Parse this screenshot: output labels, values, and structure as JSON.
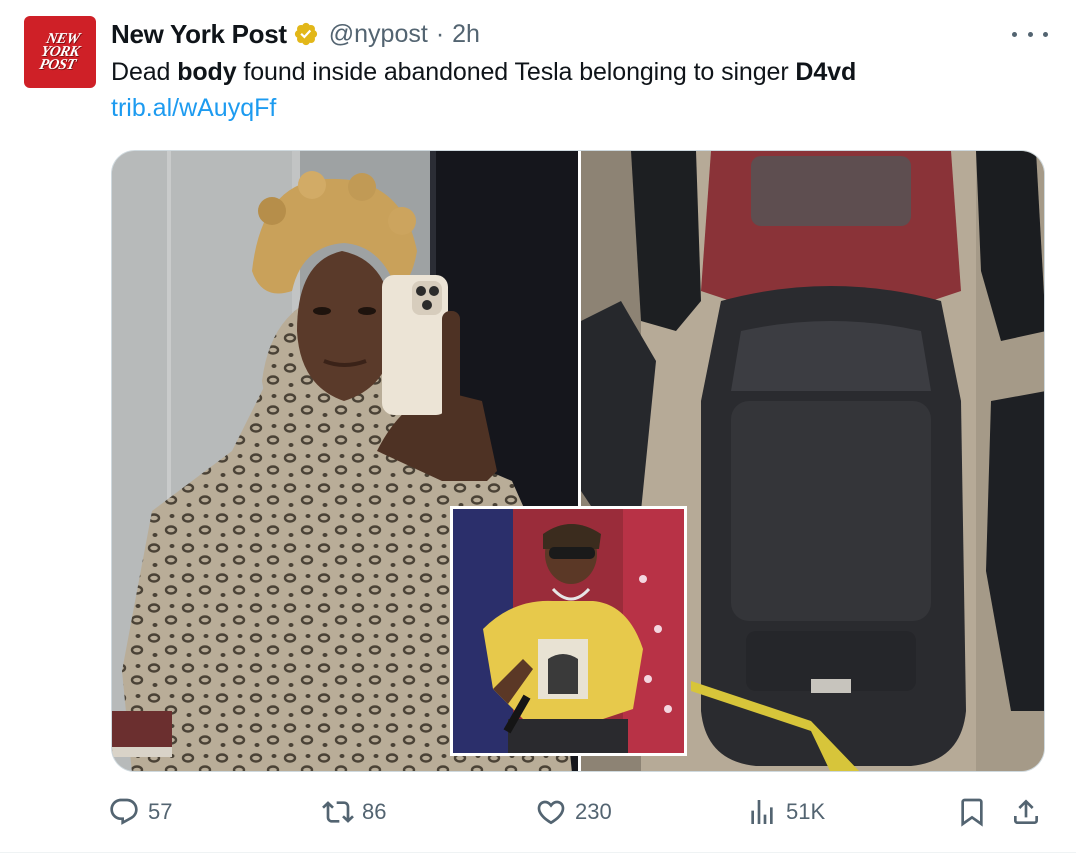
{
  "account": {
    "display_name": "New York Post",
    "handle": "@nypost",
    "separator": "·",
    "time": "2h",
    "avatar_lines": [
      "NEW",
      "YORK",
      "POST"
    ]
  },
  "tweet": {
    "text_parts": [
      {
        "text": "Dead ",
        "bold": false
      },
      {
        "text": "body",
        "bold": true
      },
      {
        "text": " found inside abandoned Tesla belonging to singer ",
        "bold": false
      },
      {
        "text": "D4vd",
        "bold": true
      }
    ],
    "link": "trib.al/wAuyqFf"
  },
  "media": {
    "photos": [
      "selfie-photo",
      "aerial-car-photo",
      "performer-inset-photo"
    ]
  },
  "actions": {
    "replies": "57",
    "reposts": "86",
    "likes": "230",
    "views": "51K"
  },
  "colors": {
    "text": "#0f1419",
    "muted": "#536471",
    "link": "#1d9bf0",
    "verified": "#e2b719",
    "brand": "#cf2027"
  },
  "icons": [
    "verified-badge-icon",
    "more-icon",
    "reply-icon",
    "retweet-icon",
    "like-icon",
    "views-icon",
    "bookmark-icon",
    "share-icon"
  ]
}
